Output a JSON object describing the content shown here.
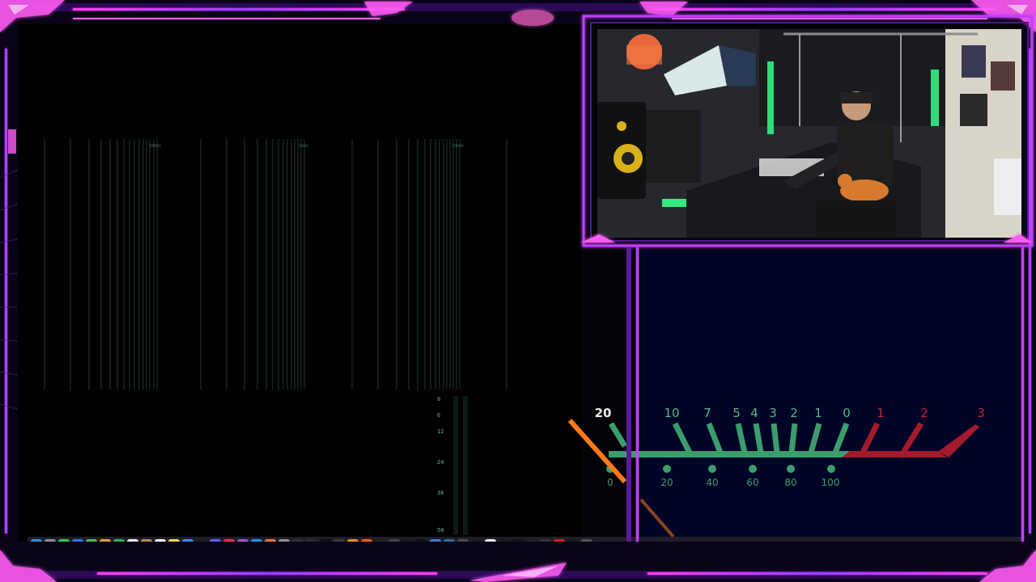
{
  "analyzer": {
    "freq_labels": [
      "100Hz",
      "1kHz",
      "10kHz"
    ],
    "meter_scale": [
      "0",
      "6",
      "12",
      "24",
      "36",
      "50"
    ]
  },
  "vu_meter": {
    "db_labels": [
      "10",
      "7",
      "5",
      "4",
      "3",
      "2",
      "1",
      "0"
    ],
    "over_labels": [
      "1",
      "2",
      "3"
    ],
    "pct_labels": [
      "20",
      "40",
      "60",
      "80",
      "100"
    ],
    "left_db": "20",
    "left_pct": "0",
    "colors": {
      "green": "#3c9d6c",
      "red": "#a31a2c",
      "needle": "#ff7a18",
      "label_green": "#55b88a",
      "label_red": "#c2233a"
    }
  },
  "dock": {
    "icons": [
      {
        "name": "finder-icon",
        "color": "#3b8bd6",
        "text": ""
      },
      {
        "name": "launchpad-icon",
        "color": "#8a8f99",
        "text": ""
      },
      {
        "name": "messages-icon",
        "color": "#34c759",
        "text": ""
      },
      {
        "name": "mail-icon",
        "color": "#2f7be8",
        "text": ""
      },
      {
        "name": "maps-icon",
        "color": "#5ab95e",
        "text": ""
      },
      {
        "name": "photos-icon",
        "color": "#e4a33c",
        "text": ""
      },
      {
        "name": "facetime-icon",
        "color": "#2fb24e",
        "text": ""
      },
      {
        "name": "calendar-icon",
        "color": "#f2f2f2",
        "text": "10"
      },
      {
        "name": "contacts-icon",
        "color": "#b98a5c",
        "text": ""
      },
      {
        "name": "reminders-icon",
        "color": "#f0f0f0",
        "text": ""
      },
      {
        "name": "notes-icon",
        "color": "#f4d35e",
        "text": ""
      },
      {
        "name": "chrome-icon",
        "color": "#4285f4",
        "text": ""
      },
      {
        "name": "tv-icon",
        "color": "#202020",
        "text": "tv"
      },
      {
        "name": "discord-icon",
        "color": "#5865f2",
        "text": ""
      },
      {
        "name": "music-icon",
        "color": "#fa2d55",
        "text": ""
      },
      {
        "name": "podcasts-icon",
        "color": "#9b59d6",
        "text": ""
      },
      {
        "name": "app-store-icon",
        "color": "#1e90ff",
        "text": ""
      },
      {
        "name": "firefox-icon",
        "color": "#ff7139",
        "text": ""
      },
      {
        "name": "settings-icon",
        "color": "#8e8e93",
        "text": ""
      },
      {
        "name": "obs-icon",
        "color": "#303030",
        "text": ""
      },
      {
        "name": "meter-app-icon",
        "color": "#2a2a2a",
        "text": ""
      },
      {
        "name": "live-icon",
        "color": "#111111",
        "text": "Live"
      },
      {
        "name": "pitch-icon",
        "color": "#3a3a3a",
        "text": ""
      },
      {
        "name": "fl-studio-icon",
        "color": "#f08a24",
        "text": ""
      },
      {
        "name": "bitwig-icon",
        "color": "#ff5a1f",
        "text": ""
      },
      {
        "name": "ma-icon",
        "color": "#222",
        "text": "MA"
      },
      {
        "name": "logic-icon",
        "color": "#444",
        "text": ""
      },
      {
        "name": "waveform-icon",
        "color": "#1b1b1b",
        "text": ""
      },
      {
        "name": "ni-icon",
        "color": "#111",
        "text": "N"
      },
      {
        "name": "melodyne-icon",
        "color": "#3b7dd8",
        "text": ""
      },
      {
        "name": "headphones-icon",
        "color": "#2b6fa6",
        "text": ""
      },
      {
        "name": "headphones-alt-icon",
        "color": "#4a4a4a",
        "text": ""
      },
      {
        "name": "ozone-icon",
        "color": "#1d1d1d",
        "text": "OZN"
      },
      {
        "name": "ds-icon",
        "color": "#eeeeee",
        "text": "ds"
      },
      {
        "name": "terminal-icon",
        "color": "#1c1c1c",
        "text": ""
      },
      {
        "name": "waves-icon",
        "color": "#111",
        "text": "W"
      },
      {
        "name": "plugin-alliance-icon",
        "color": "#222",
        "text": ""
      },
      {
        "name": "nav-arrow-icon",
        "color": "#333",
        "text": ""
      },
      {
        "name": "ik-icon",
        "color": "#d4202a",
        "text": ""
      },
      {
        "name": "s-app-icon",
        "color": "#1a1a1a",
        "text": "S"
      },
      {
        "name": "globe-icon",
        "color": "#555",
        "text": ""
      }
    ]
  }
}
